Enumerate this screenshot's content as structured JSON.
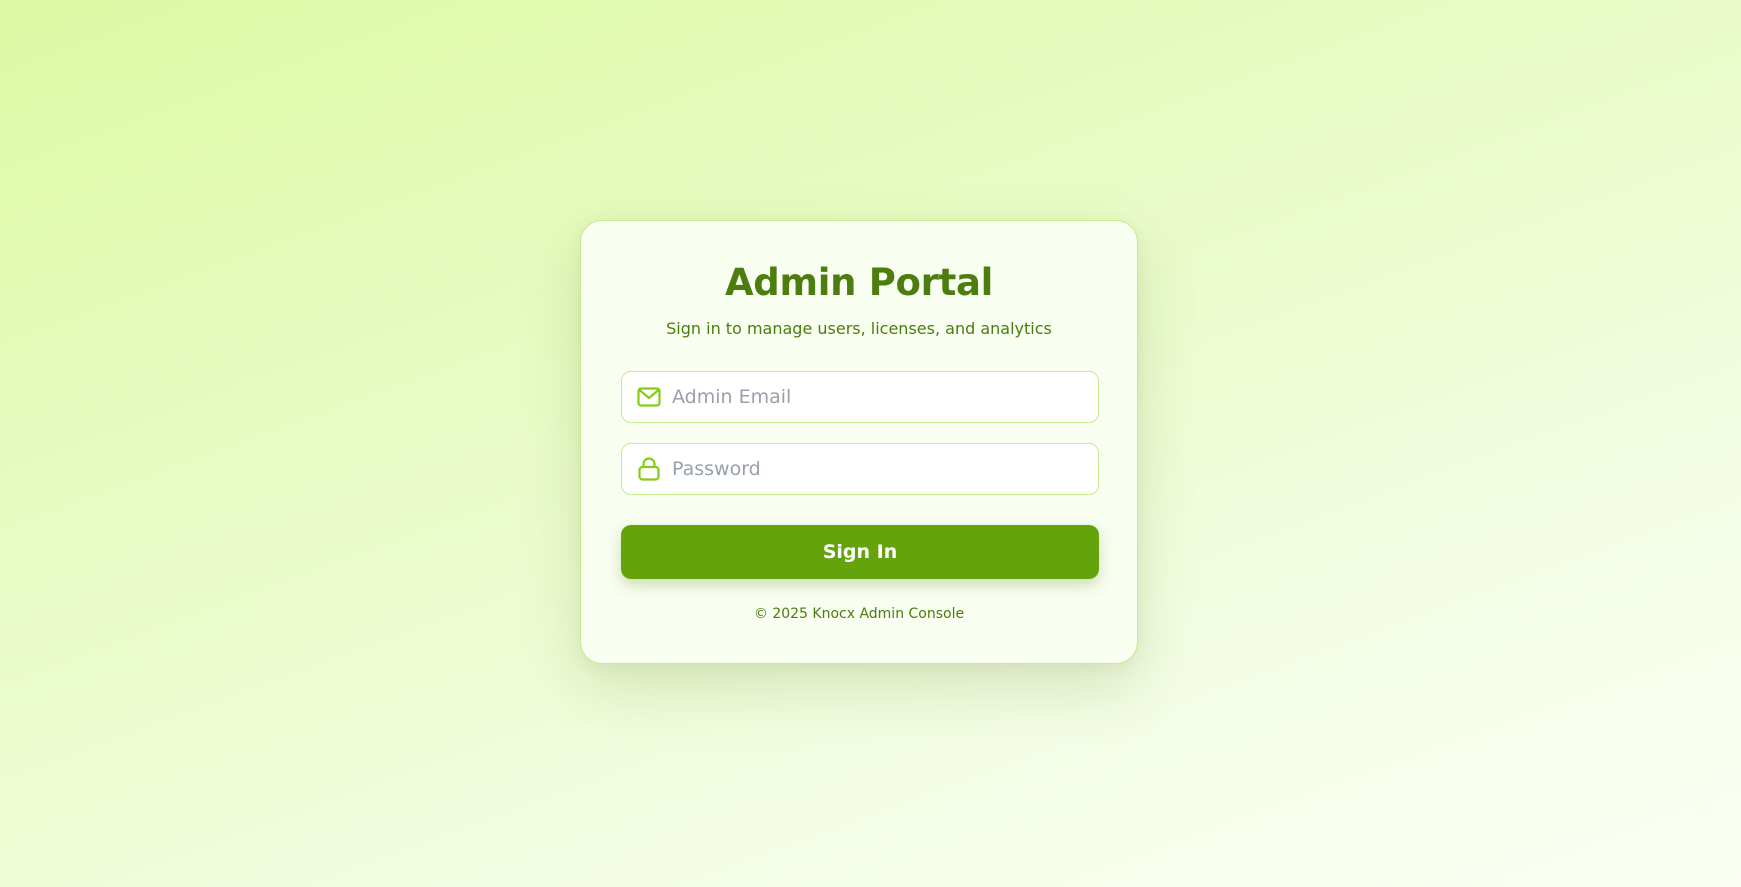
{
  "login": {
    "title": "Admin Portal",
    "subtitle": "Sign in to manage users, licenses, and analytics",
    "email": {
      "placeholder": "Admin Email",
      "value": "",
      "icon": "mail-icon"
    },
    "password": {
      "placeholder": "Password",
      "value": "",
      "icon": "lock-icon"
    },
    "submit_label": "Sign In",
    "footer": "© 2025 Knocx Admin Console"
  },
  "colors": {
    "accent": "#65a30d",
    "text_green": "#4d7c0f",
    "border_green": "#c6ec8d",
    "icon_green": "#84cc16",
    "placeholder_gray": "#9aa0ab"
  }
}
